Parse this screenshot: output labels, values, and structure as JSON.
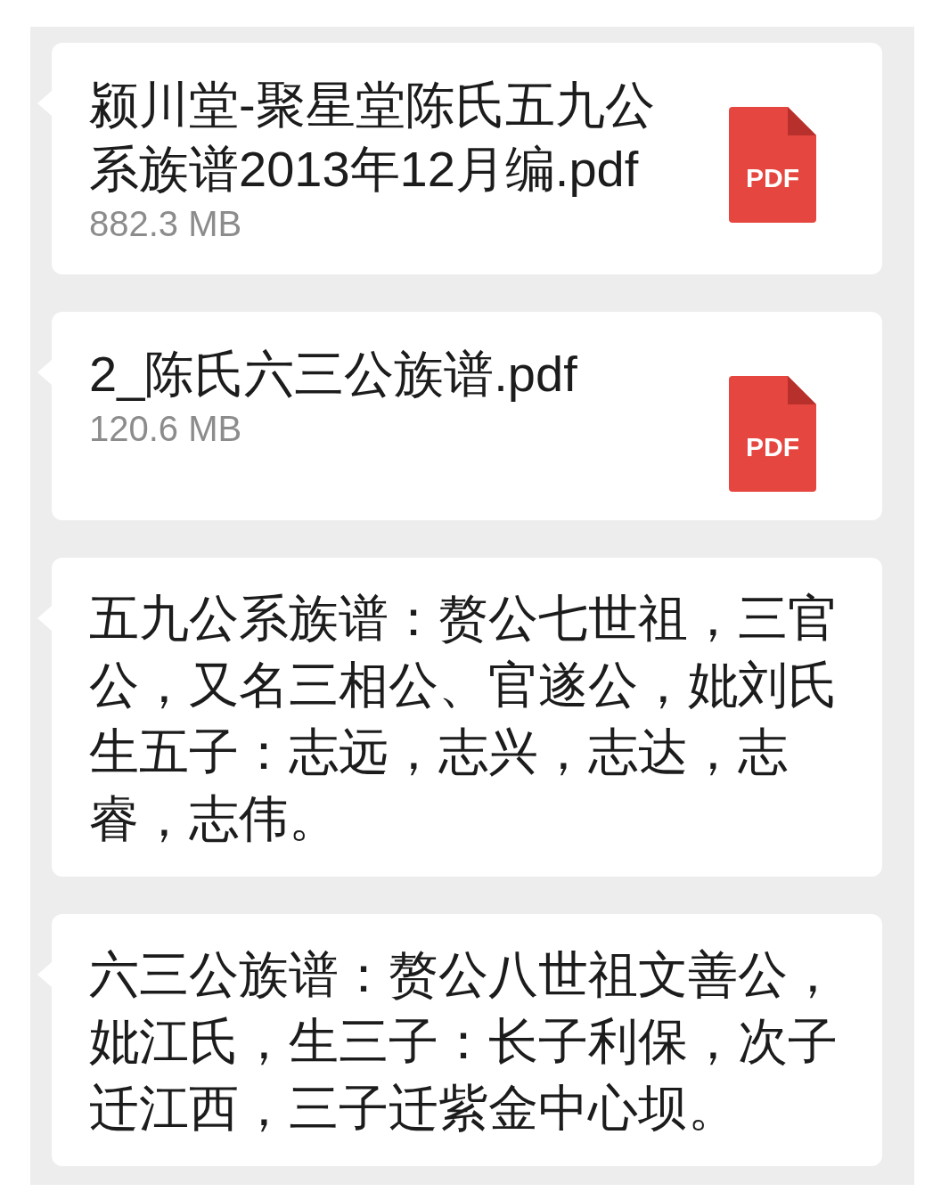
{
  "messages": [
    {
      "kind": "file",
      "name": "颍川堂-聚星堂陈氏五九公系族谱2013年12月编.pdf",
      "size": "882.3 MB",
      "type_label": "PDF"
    },
    {
      "kind": "file",
      "name": "2_陈氏六三公族谱.pdf",
      "size": "120.6 MB",
      "type_label": "PDF"
    },
    {
      "kind": "text",
      "text": "五九公系族谱：赘公七世祖，三官公，又名三相公、官遂公，妣刘氏生五子：志远，志兴，志达，志睿，志伟。"
    },
    {
      "kind": "text",
      "text": "六三公族谱：赘公八世祖文善公，妣江氏，生三子：长子利保，次子迁江西，三子迁紫金中心坝。"
    }
  ]
}
